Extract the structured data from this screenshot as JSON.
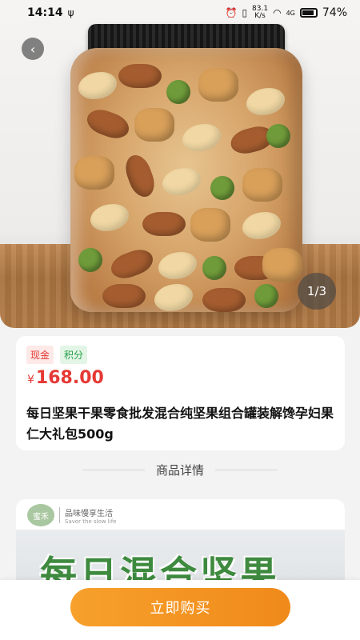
{
  "status_bar": {
    "time": "14:14",
    "netspeed_value": "83.1",
    "netspeed_unit": "K/s",
    "signal": "4G",
    "battery": "74%"
  },
  "gallery": {
    "indicator": "1/3"
  },
  "product": {
    "tags": [
      "现金",
      "积分"
    ],
    "currency_symbol": "¥",
    "price": "168.00",
    "title": "每日坚果干果零食批发混合纯坚果组合罐装解馋孕妇果仁大礼包500g"
  },
  "details": {
    "section_title": "商品详情",
    "brand_logo": "蜜禾",
    "brand_slogan": "品味慢享生活",
    "brand_slogan_en": "Savor the slow life",
    "banner_text": "每日混合坚果"
  },
  "actions": {
    "buy_now": "立即购买"
  },
  "icons": {
    "back": "chevron-left-icon",
    "usb": "usb-icon",
    "alarm": "alarm-icon",
    "vibrate": "vibrate-icon",
    "wifi": "wifi-icon",
    "battery": "battery-icon"
  },
  "colors": {
    "price_red": "#e53935",
    "points_green": "#27a04a",
    "buy_orange": "#f39420"
  }
}
